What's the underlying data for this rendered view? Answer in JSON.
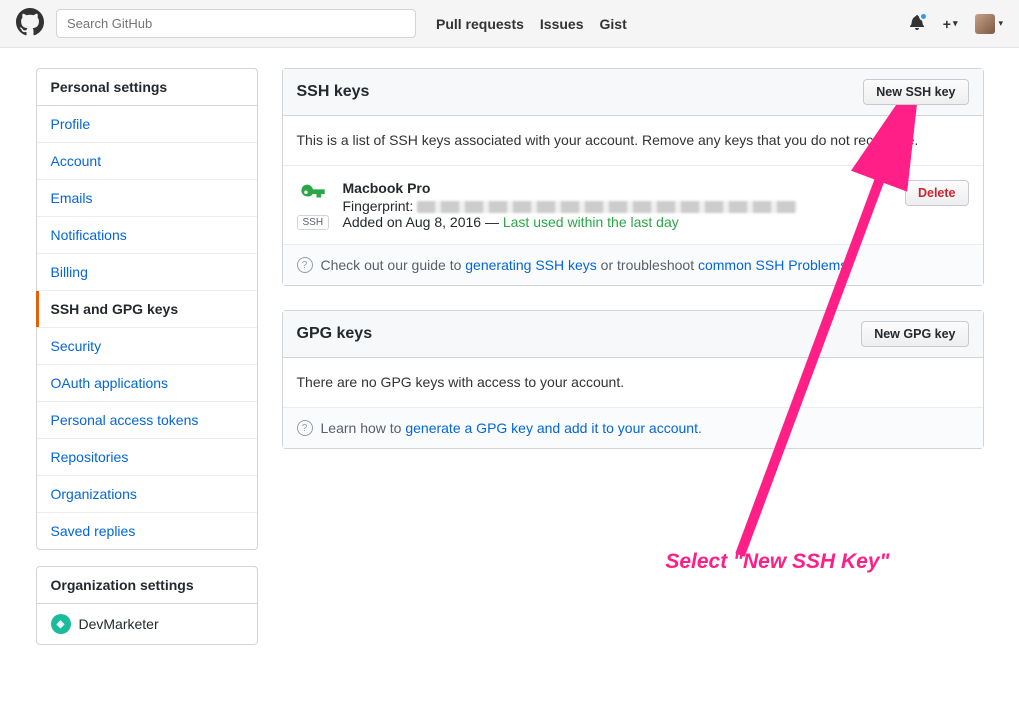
{
  "header": {
    "search_placeholder": "Search GitHub",
    "nav": {
      "pull_requests": "Pull requests",
      "issues": "Issues",
      "gist": "Gist"
    },
    "plus_label": "+"
  },
  "sidebar": {
    "personal_heading": "Personal settings",
    "items": [
      {
        "label": "Profile"
      },
      {
        "label": "Account"
      },
      {
        "label": "Emails"
      },
      {
        "label": "Notifications"
      },
      {
        "label": "Billing"
      },
      {
        "label": "SSH and GPG keys"
      },
      {
        "label": "Security"
      },
      {
        "label": "OAuth applications"
      },
      {
        "label": "Personal access tokens"
      },
      {
        "label": "Repositories"
      },
      {
        "label": "Organizations"
      },
      {
        "label": "Saved replies"
      }
    ],
    "org_heading": "Organization settings",
    "org_name": "DevMarketer"
  },
  "ssh": {
    "heading": "SSH keys",
    "new_button": "New SSH key",
    "description": "This is a list of SSH keys associated with your account. Remove any keys that you do not recognize.",
    "key": {
      "name": "Macbook Pro",
      "fingerprint_label": "Fingerprint:",
      "added_prefix": "Added on Aug 8, 2016 — ",
      "last_used": "Last used within the last day",
      "badge": "SSH",
      "delete_label": "Delete"
    },
    "footer": {
      "prefix": "Check out our guide to ",
      "link1": "generating SSH keys",
      "middle": " or troubleshoot ",
      "link2": "common SSH Problems",
      "suffix": "."
    }
  },
  "gpg": {
    "heading": "GPG keys",
    "new_button": "New GPG key",
    "description": "There are no GPG keys with access to your account.",
    "footer": {
      "prefix": "Learn how to ",
      "link": "generate a GPG key and add it to your account",
      "suffix": "."
    }
  },
  "annotation": {
    "text": "Select \"New SSH Key\""
  }
}
